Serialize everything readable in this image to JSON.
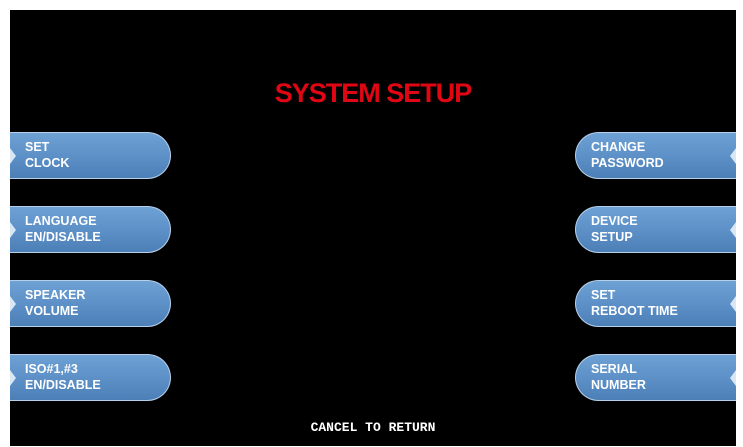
{
  "screen": {
    "title": "SYSTEM SETUP",
    "title_color": "#e10613",
    "button_color": "#5b8fc6",
    "footer": "CANCEL TO RETURN"
  },
  "left_buttons": [
    {
      "line1": "SET",
      "line2": "CLOCK"
    },
    {
      "line1": "LANGUAGE",
      "line2": "EN/DISABLE"
    },
    {
      "line1": "SPEAKER",
      "line2": "VOLUME"
    },
    {
      "line1": "ISO#1,#3",
      "line2": "EN/DISABLE"
    }
  ],
  "right_buttons": [
    {
      "line1": "CHANGE",
      "line2": "PASSWORD"
    },
    {
      "line1": "DEVICE",
      "line2": "SETUP"
    },
    {
      "line1": "SET",
      "line2": "REBOOT TIME"
    },
    {
      "line1": "SERIAL",
      "line2": "NUMBER"
    }
  ]
}
